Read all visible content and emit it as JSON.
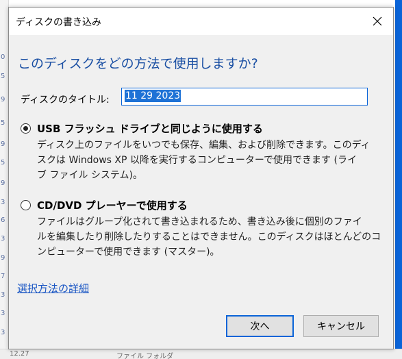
{
  "dialog": {
    "title": "ディスクの書き込み",
    "heading": "このディスクをどの方法で使用しますか?",
    "disc_title_label": "ディスクのタイトル:",
    "disc_title_value": "11 29 2023",
    "option_usb": {
      "title": "USB フラッシュ ドライブと同じように使用する",
      "desc_lines": [
        "ディスク上のファイルをいつでも保存、編集、および削除できます。このディ",
        "スクは Windows XP 以降を実行するコンピューターで使用できます (ライ",
        "ブ ファイル システム)。"
      ],
      "selected": true
    },
    "option_cd": {
      "title": "CD/DVD プレーヤーで使用する",
      "desc_lines": [
        "ファイルはグループ化されて書き込まれるため、書き込み後に個別のファイ",
        "ルを編集したり削除したりすることはできません。このディスクはほとんどのコ",
        "ンピューターで使用できます (マスター)。"
      ],
      "selected": false
    },
    "more_link": "選択方法の詳細",
    "next_button": "次へ",
    "cancel_button": "キャンセル"
  },
  "background": {
    "left_marks": [
      "0",
      "5",
      "9",
      "5",
      "9",
      "5",
      "9",
      "3",
      "6",
      "3",
      "9",
      "7",
      "3",
      "3",
      "3"
    ],
    "bottom_texts": [
      "12.27",
      "ファイル フォルダ"
    ]
  },
  "colors": {
    "heading": "#1a4fa3",
    "link": "#1a56c4",
    "selection": "#1e72d6",
    "accent": "#0a64d8"
  }
}
